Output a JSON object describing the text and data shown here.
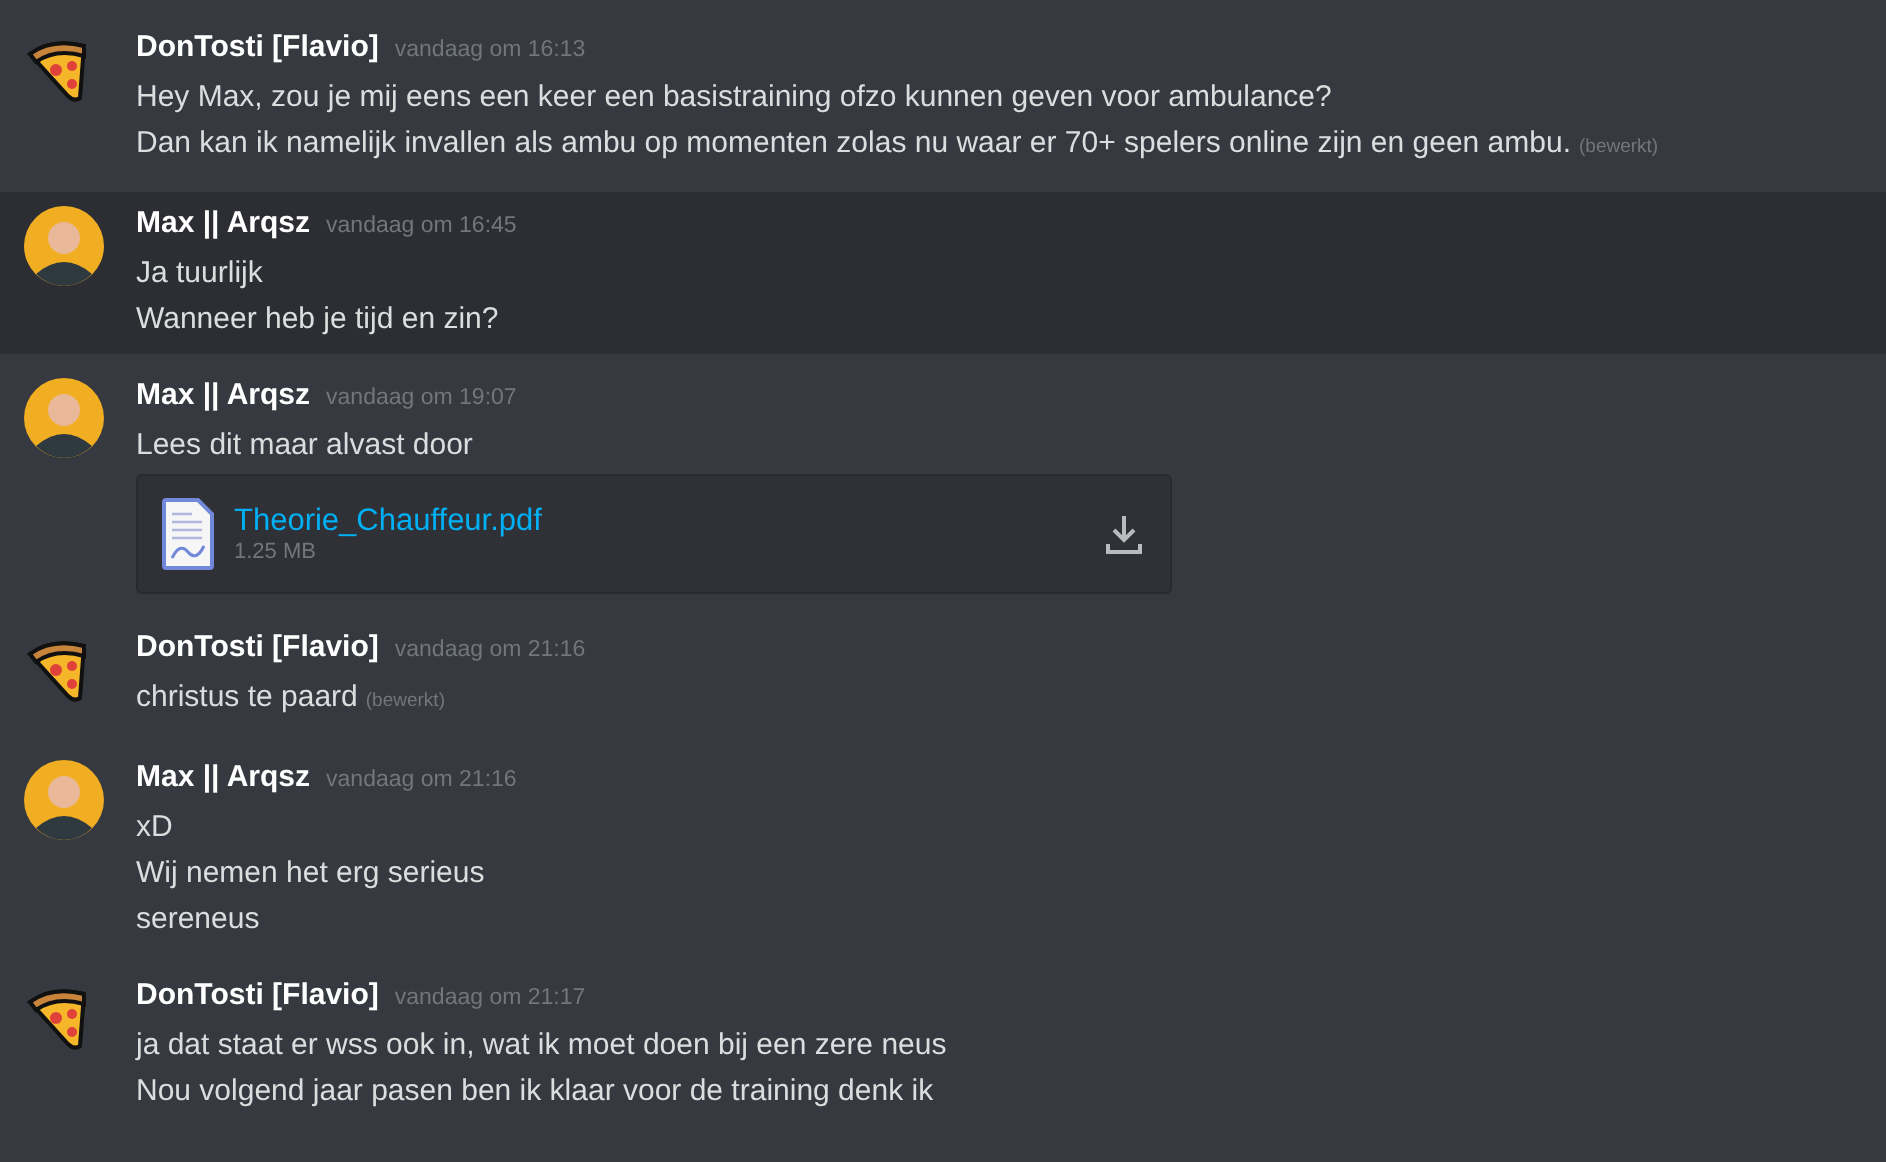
{
  "messages": [
    {
      "author": "DonTosti [Flavio]",
      "kind": "pizza",
      "time": "vandaag om 16:13",
      "highlighted": false,
      "lines": [
        {
          "text": "Hey Max, zou je mij eens een keer een basistraining ofzo kunnen geven voor ambulance?"
        },
        {
          "text": "Dan kan ik namelijk invallen als ambu op momenten zolas nu waar er 70+ spelers online zijn en geen ambu.",
          "edited_label": "(bewerkt)"
        }
      ]
    },
    {
      "author": "Max || Arqsz",
      "kind": "person",
      "time": "vandaag om 16:45",
      "highlighted": true,
      "lines": [
        {
          "text": "Ja tuurlijk"
        },
        {
          "text": "Wanneer heb je tijd en zin?"
        }
      ]
    },
    {
      "author": "Max || Arqsz",
      "kind": "person",
      "time": "vandaag om 19:07",
      "highlighted": false,
      "lines": [
        {
          "text": "Lees dit maar alvast door"
        }
      ],
      "attachment": {
        "filename": "Theorie_Chauffeur.pdf",
        "size": "1.25 MB"
      }
    },
    {
      "author": "DonTosti [Flavio]",
      "kind": "pizza",
      "time": "vandaag om 21:16",
      "highlighted": false,
      "lines": [
        {
          "text": "christus te paard",
          "edited_label": "(bewerkt)"
        }
      ]
    },
    {
      "author": "Max || Arqsz",
      "kind": "person",
      "time": "vandaag om 21:16",
      "highlighted": false,
      "lines": [
        {
          "text": "xD"
        },
        {
          "text": "Wij nemen het erg serieus"
        },
        {
          "text": "sereneus"
        }
      ]
    },
    {
      "author": "DonTosti [Flavio]",
      "kind": "pizza",
      "time": "vandaag om 21:17",
      "highlighted": false,
      "lines": [
        {
          "text": "ja dat staat er wss ook in, wat ik moet doen bij een zere neus"
        },
        {
          "text": "Nou volgend jaar pasen ben ik klaar voor de training denk ik"
        }
      ]
    }
  ]
}
